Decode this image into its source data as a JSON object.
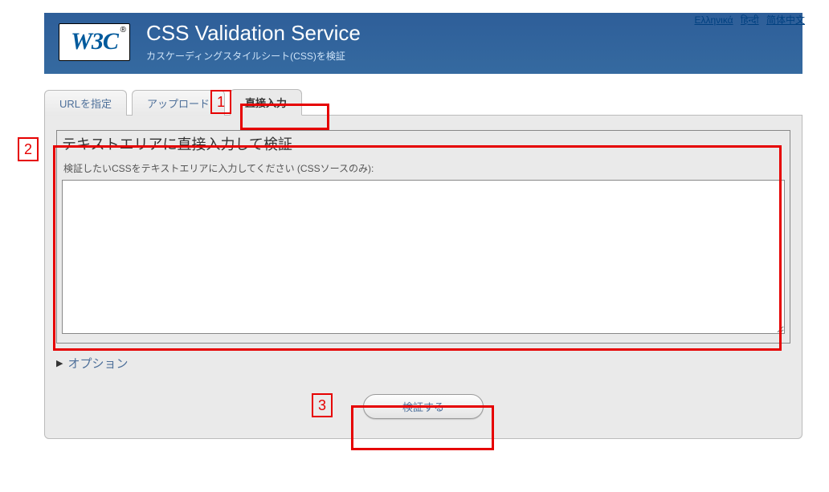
{
  "lang_links": {
    "greek": "Ελληνικά",
    "hindi": "हिन्दी",
    "zh_simplified": "简体中文"
  },
  "logo": {
    "text": "W3C",
    "registered": "®"
  },
  "banner": {
    "title": "CSS Validation Service",
    "subtitle": "カスケーディングスタイルシート(CSS)を検証"
  },
  "tabs": {
    "by_uri": "URLを指定",
    "by_upload": "アップロード",
    "by_input": "直接入力"
  },
  "section": {
    "title": "テキストエリアに直接入力して検証",
    "hint": "検証したいCSSをテキストエリアに入力してください (CSSソースのみ):"
  },
  "options": {
    "label": "オプション"
  },
  "submit": {
    "label": "検証する"
  },
  "annotations": {
    "n1": "1",
    "n2": "2",
    "n3": "3"
  }
}
